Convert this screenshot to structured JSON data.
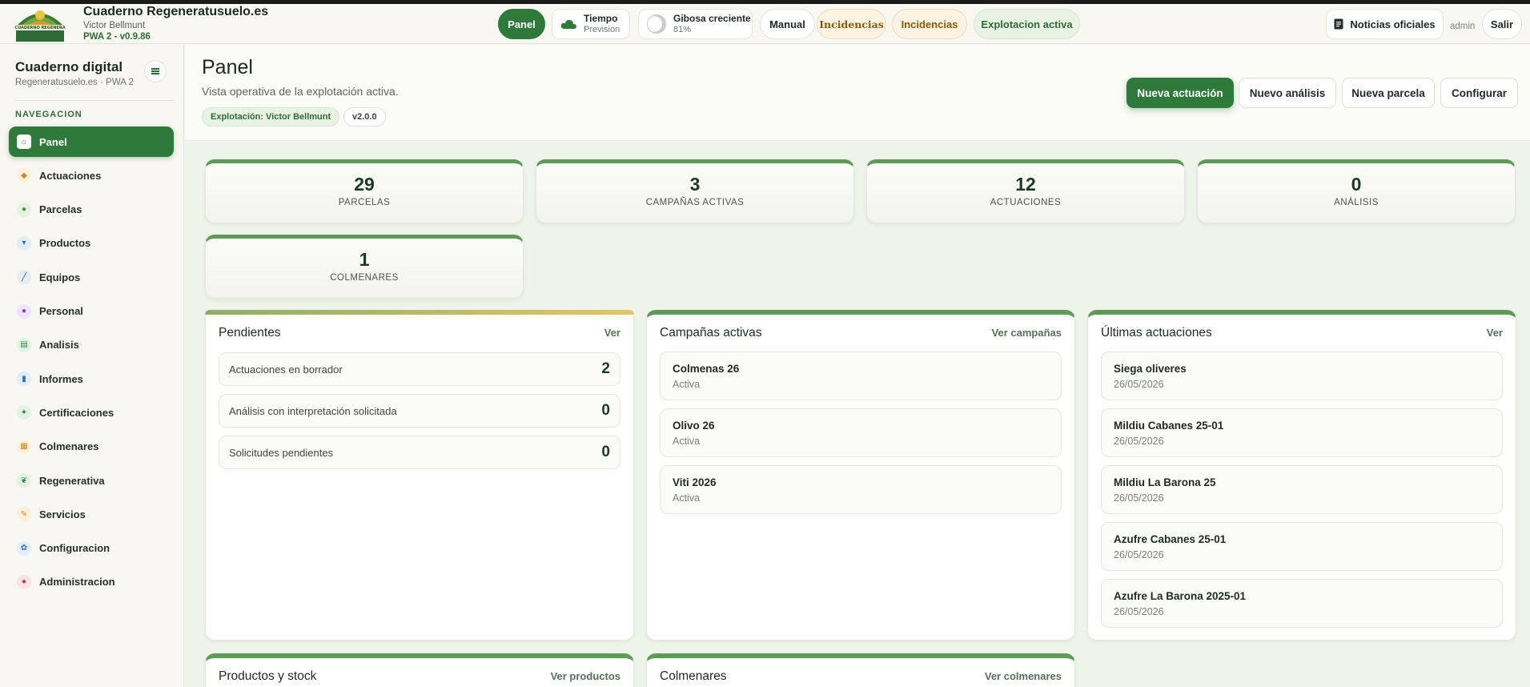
{
  "header": {
    "brand_title": "Cuaderno Regeneratusuelo.es",
    "brand_user": "Victor Bellmunt",
    "brand_version": "PWA 2 - v0.9.86",
    "logo_text": "CUADERNO REGENERA",
    "panel_label": "Panel",
    "weather_title": "Tiempo",
    "weather_sub": "Prevision",
    "moon_title": "Gibosa creciente",
    "moon_sub": "81%",
    "manual_label": "Manual",
    "incidencias1_label": "Incidencias",
    "incidencias2_label": "Incidencias",
    "explotacion_label": "Explotacion activa",
    "news_label": "Noticias oficiales",
    "user_label": "admin",
    "logout_label": "Salir"
  },
  "sidebar": {
    "title": "Cuaderno digital",
    "subtitle": "Regeneratusuelo.es · PWA 2",
    "section": "NAVEGACION",
    "items": [
      {
        "label": "Panel",
        "icon": "home-icon",
        "color": "#2e7a3a",
        "bg": "#ffffff"
      },
      {
        "label": "Actuaciones",
        "icon": "tag-icon",
        "color": "#c98a1a",
        "bg": "#fbf0dc"
      },
      {
        "label": "Parcelas",
        "icon": "pin-icon",
        "color": "#4a8f3b",
        "bg": "#e6f1e1"
      },
      {
        "label": "Productos",
        "icon": "cart-icon",
        "color": "#2e6fb6",
        "bg": "#e3edf8"
      },
      {
        "label": "Equipos",
        "icon": "hammer-icon",
        "color": "#3c5a73",
        "bg": "#e6ecf1"
      },
      {
        "label": "Personal",
        "icon": "people-icon",
        "color": "#8a3ecf",
        "bg": "#efe4fa"
      },
      {
        "label": "Analisis",
        "icon": "sheet-icon",
        "color": "#2f8a44",
        "bg": "#e2f2e4"
      },
      {
        "label": "Informes",
        "icon": "bar-chart-icon",
        "color": "#2e6fb6",
        "bg": "#e3edf8"
      },
      {
        "label": "Certificaciones",
        "icon": "award-icon",
        "color": "#2f8a44",
        "bg": "#e2f2e4"
      },
      {
        "label": "Colmenares",
        "icon": "grid-icon",
        "color": "#d08a12",
        "bg": "#fbf0dc"
      },
      {
        "label": "Regenerativa",
        "icon": "leaf-icon",
        "color": "#2f8a44",
        "bg": "#e2f2e4"
      },
      {
        "label": "Servicios",
        "icon": "wrench-icon",
        "color": "#c98a1a",
        "bg": "#fbf0dc"
      },
      {
        "label": "Configuracion",
        "icon": "gear-icon",
        "color": "#2e6fb6",
        "bg": "#e3edf8"
      },
      {
        "label": "Administracion",
        "icon": "user-icon",
        "color": "#c63a3a",
        "bg": "#f9e3e3"
      }
    ]
  },
  "page": {
    "title": "Panel",
    "subtitle": "Vista operativa de la explotación activa.",
    "tag_explotacion": "Explotación: Victor Bellmunt",
    "tag_version": "v2.0.0",
    "actions": {
      "nueva_actuacion": "Nueva actuación",
      "nuevo_analisis": "Nuevo análisis",
      "nueva_parcela": "Nueva parcela",
      "configurar": "Configurar"
    }
  },
  "stats": [
    {
      "value": "29",
      "label": "PARCELAS"
    },
    {
      "value": "3",
      "label": "CAMPAÑAS ACTIVAS"
    },
    {
      "value": "12",
      "label": "ACTUACIONES"
    },
    {
      "value": "0",
      "label": "ANÁLISIS"
    },
    {
      "value": "1",
      "label": "COLMENARES"
    }
  ],
  "pendientes": {
    "title": "Pendientes",
    "link": "Ver",
    "rows": [
      {
        "label": "Actuaciones en borrador",
        "value": "2"
      },
      {
        "label": "Análisis con interpretación solicitada",
        "value": "0"
      },
      {
        "label": "Solicitudes pendientes",
        "value": "0"
      }
    ]
  },
  "campanas": {
    "title": "Campañas activas",
    "link": "Ver campañas",
    "rows": [
      {
        "name": "Colmenas 26",
        "status": "Activa"
      },
      {
        "name": "Olivo 26",
        "status": "Activa"
      },
      {
        "name": "Viti 2026",
        "status": "Activa"
      }
    ]
  },
  "ultimas": {
    "title": "Últimas actuaciones",
    "link": "Ver",
    "rows": [
      {
        "name": "Siega oliveres",
        "date": "26/05/2026"
      },
      {
        "name": "Mildiu Cabanes 25-01",
        "date": "26/05/2026"
      },
      {
        "name": "Mildiu La Barona 25",
        "date": "26/05/2026"
      },
      {
        "name": "Azufre Cabanes 25-01",
        "date": "26/05/2026"
      },
      {
        "name": "Azufre La Barona 2025-01",
        "date": "26/05/2026"
      }
    ]
  },
  "productos": {
    "title": "Productos y stock",
    "link": "Ver productos"
  },
  "colmenares": {
    "title": "Colmenares",
    "link": "Ver colmenares"
  }
}
